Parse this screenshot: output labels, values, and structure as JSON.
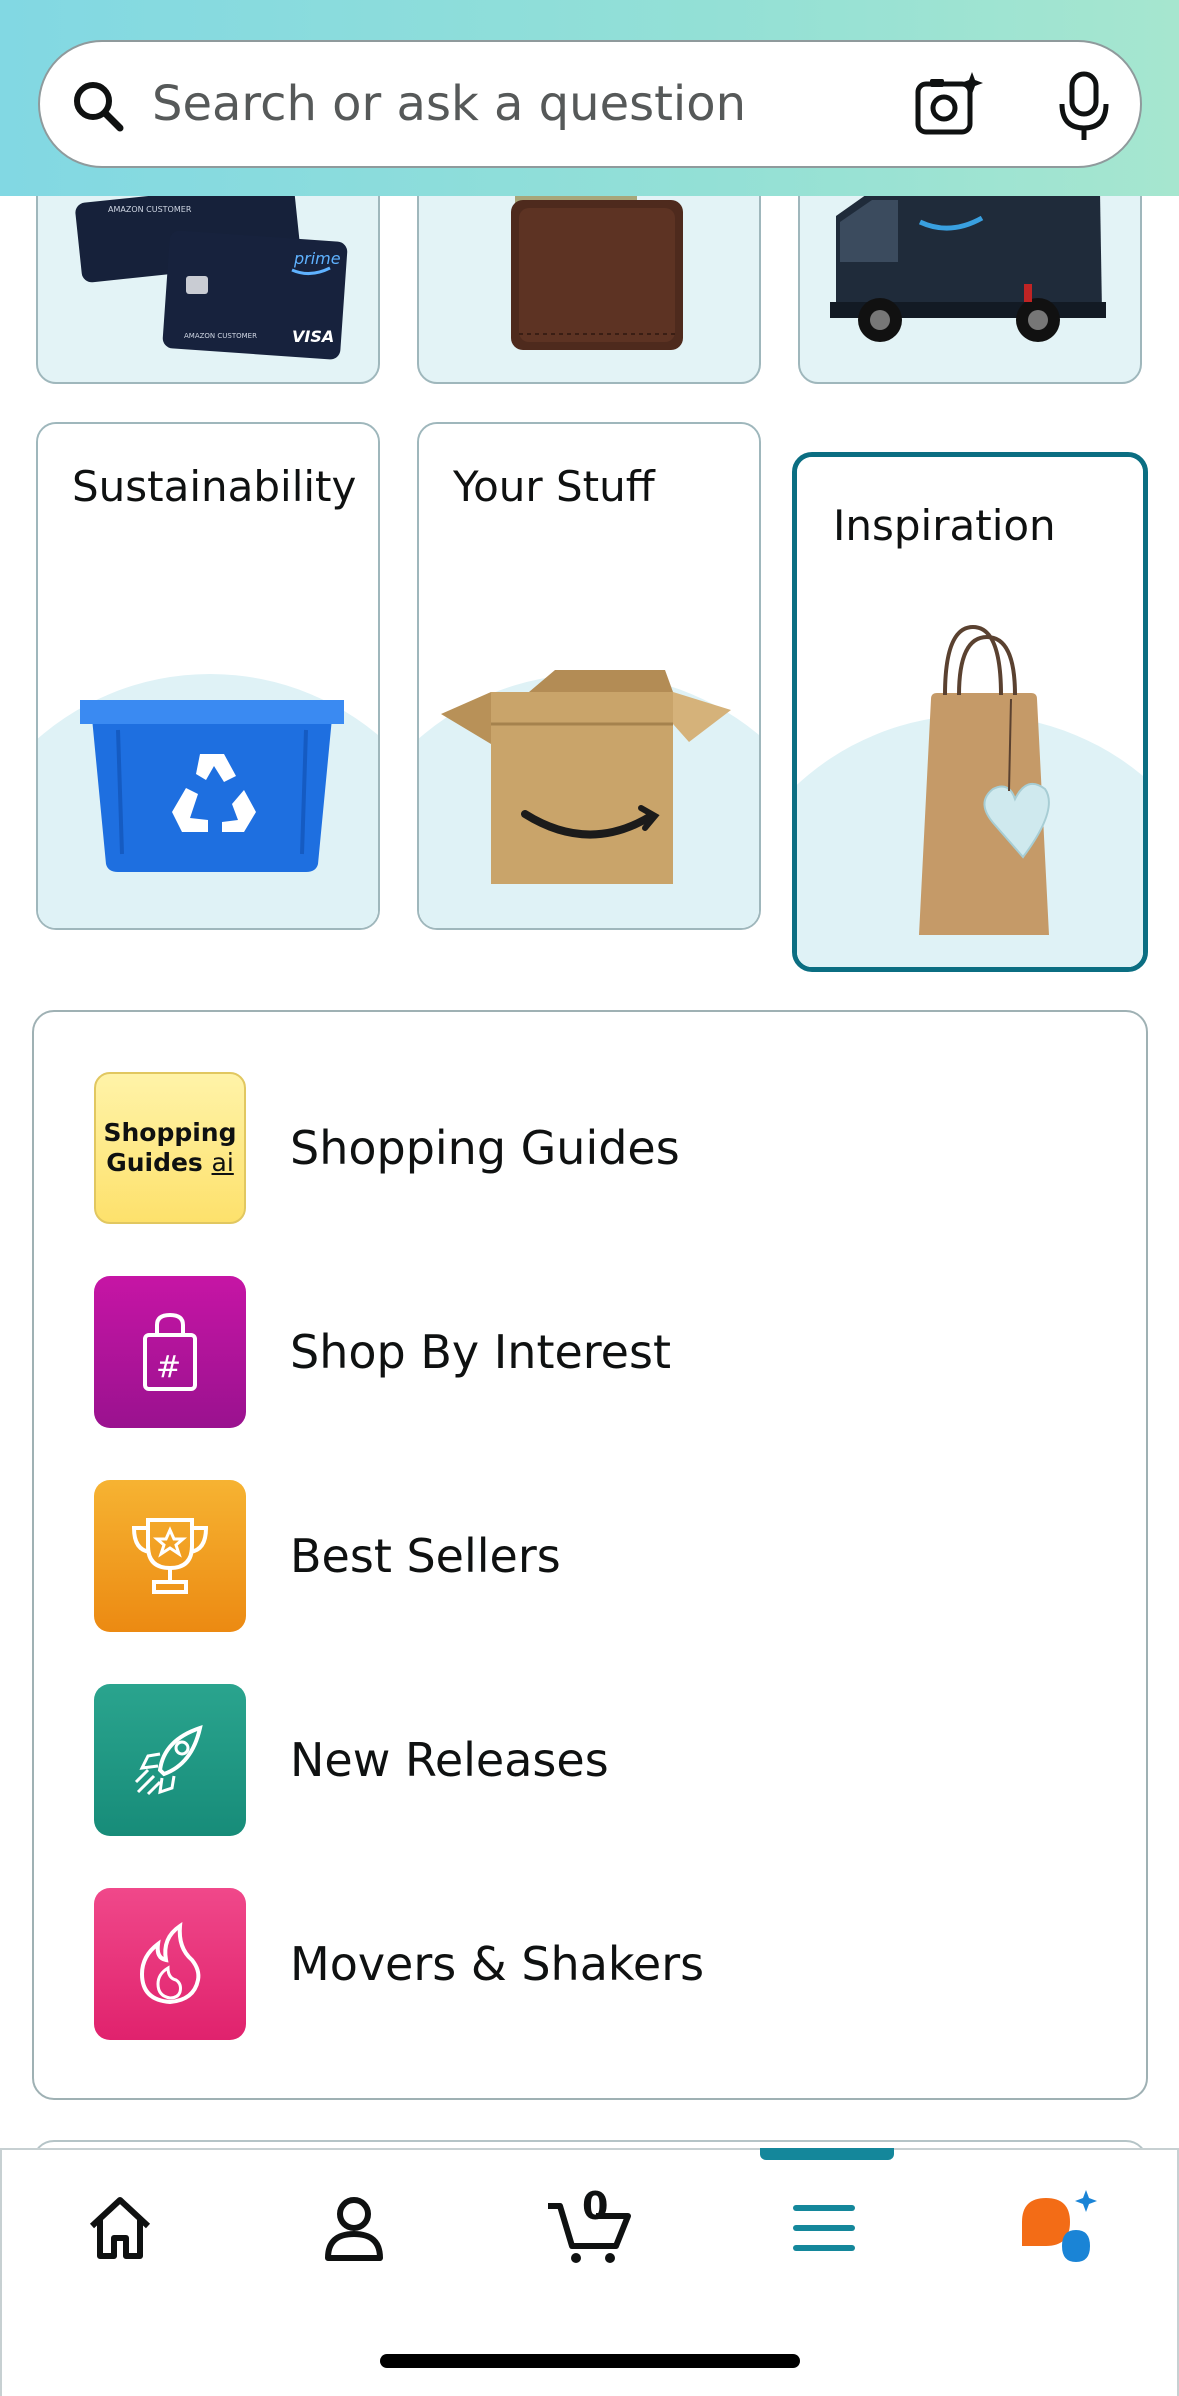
{
  "search": {
    "placeholder": "Search or ask a question"
  },
  "tiles_top": [
    {
      "name": "prime-card-tile",
      "card_text": "prime",
      "card_brand": "VISA",
      "card_holder": "AMAZON CUSTOMER"
    },
    {
      "name": "wallet-tile"
    },
    {
      "name": "delivery-van-tile"
    }
  ],
  "tiles": [
    {
      "title": "Sustainability"
    },
    {
      "title": "Your Stuff"
    },
    {
      "title": "Inspiration"
    }
  ],
  "list": [
    {
      "label": "Shopping Guides",
      "icon": "shopping-guides-icon",
      "icon_text_1": "Shopping",
      "icon_text_2": "Guides",
      "icon_text_3": "ai"
    },
    {
      "label": "Shop By Interest",
      "icon": "shopping-bag-hashtag-icon"
    },
    {
      "label": "Best Sellers",
      "icon": "trophy-icon"
    },
    {
      "label": "New Releases",
      "icon": "rocket-icon"
    },
    {
      "label": "Movers & Shakers",
      "icon": "flame-icon"
    }
  ],
  "nav": {
    "cart_count": "0",
    "items": [
      "home-icon",
      "account-icon",
      "cart-icon",
      "menu-icon",
      "rufus-assistant-icon"
    ],
    "active": "menu-icon"
  },
  "colors": {
    "accent": "#14879b",
    "tile_bg": "#e3f3f6",
    "active_border": "#0b6e82"
  }
}
